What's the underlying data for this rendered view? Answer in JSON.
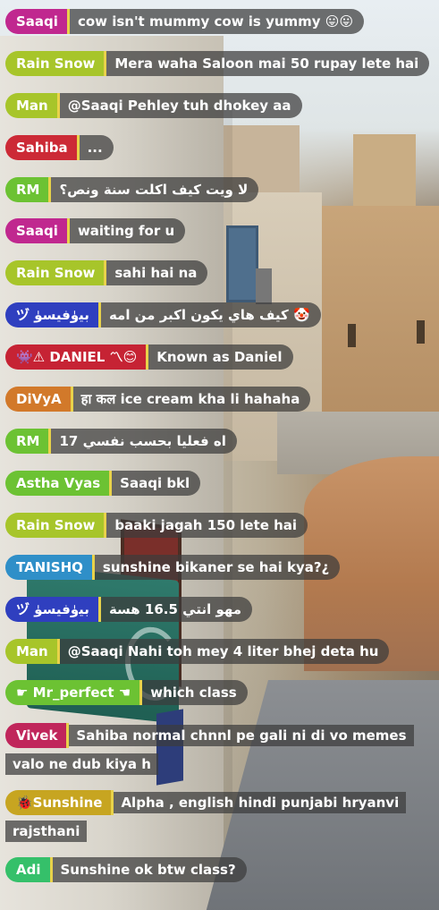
{
  "messages": [
    {
      "user": "Saaqi",
      "text": "cow isn't mummy cow is yummy 😛😛",
      "color": "#c0288f"
    },
    {
      "user": "Rain Snow",
      "text": "Mera waha Saloon mai 50 rupay lete hai",
      "color": "#a7c52a"
    },
    {
      "user": "Man",
      "text": "@Saaqi Pehley tuh dhokey aa",
      "color": "#a7c52a"
    },
    {
      "user": "Sahiba",
      "text": "...",
      "color": "#cc2a36"
    },
    {
      "user": "RM",
      "text": "لا ويت كيف اكلت سنة ونص؟",
      "color": "#6cc233"
    },
    {
      "user": "Saaqi",
      "text": "waiting for u",
      "color": "#c0288f"
    },
    {
      "user": "Rain Snow",
      "text": "sahi hai na",
      "color": "#a7c52a"
    },
    {
      "user": "ヅ ﺑﻴﯛﻓﻴﺴﯜ",
      "text": "🤡 كيف هاي يكون اكبر من امه",
      "color": "#2f3fbf"
    },
    {
      "user": "👾⚠ DANIEL 〽😊",
      "text": "Known as Daniel",
      "color": "#c62334"
    },
    {
      "user": "DiVyA",
      "text": "हा कल ice cream kha li hahaha",
      "color": "#d2792a"
    },
    {
      "user": "RM",
      "text": "اه فعليا بحسب نفسي 17",
      "color": "#6cc233"
    },
    {
      "user": "Astha Vyas",
      "text": "Saaqi bkl",
      "color": "#6cc233"
    },
    {
      "user": "Rain Snow",
      "text": "baaki jagah 150 lete hai",
      "color": "#a7c52a"
    },
    {
      "user": "TANISHQ",
      "text": "sunshine bikaner se hai kya?¿",
      "color": "#2f8fc8"
    },
    {
      "user": "ヅ ﺑﻴﯛﻓﻴﺴﯜ",
      "text": "مهو انتي 16.5 هسة",
      "color": "#2f3fbf"
    },
    {
      "user": "Man",
      "text": "@Saaqi Nahi toh mey 4 liter bhej deta hu",
      "color": "#a7c52a"
    },
    {
      "user": "☛ Mr_perfect ☚",
      "text": "which class",
      "color": "#6cc233"
    },
    {
      "user": "Vivek",
      "text": "Sahiba normal chnnl pe gali ni di vo memes valo ne dub kiya h",
      "color": "#c0265b"
    },
    {
      "user": "🐞Sunshine",
      "text": "Alpha , english hindi punjabi hryanvi rajsthani",
      "color": "#c7a521"
    },
    {
      "user": "Adi",
      "text": "Sunshine ok btw class?",
      "color": "#35c06a"
    }
  ]
}
